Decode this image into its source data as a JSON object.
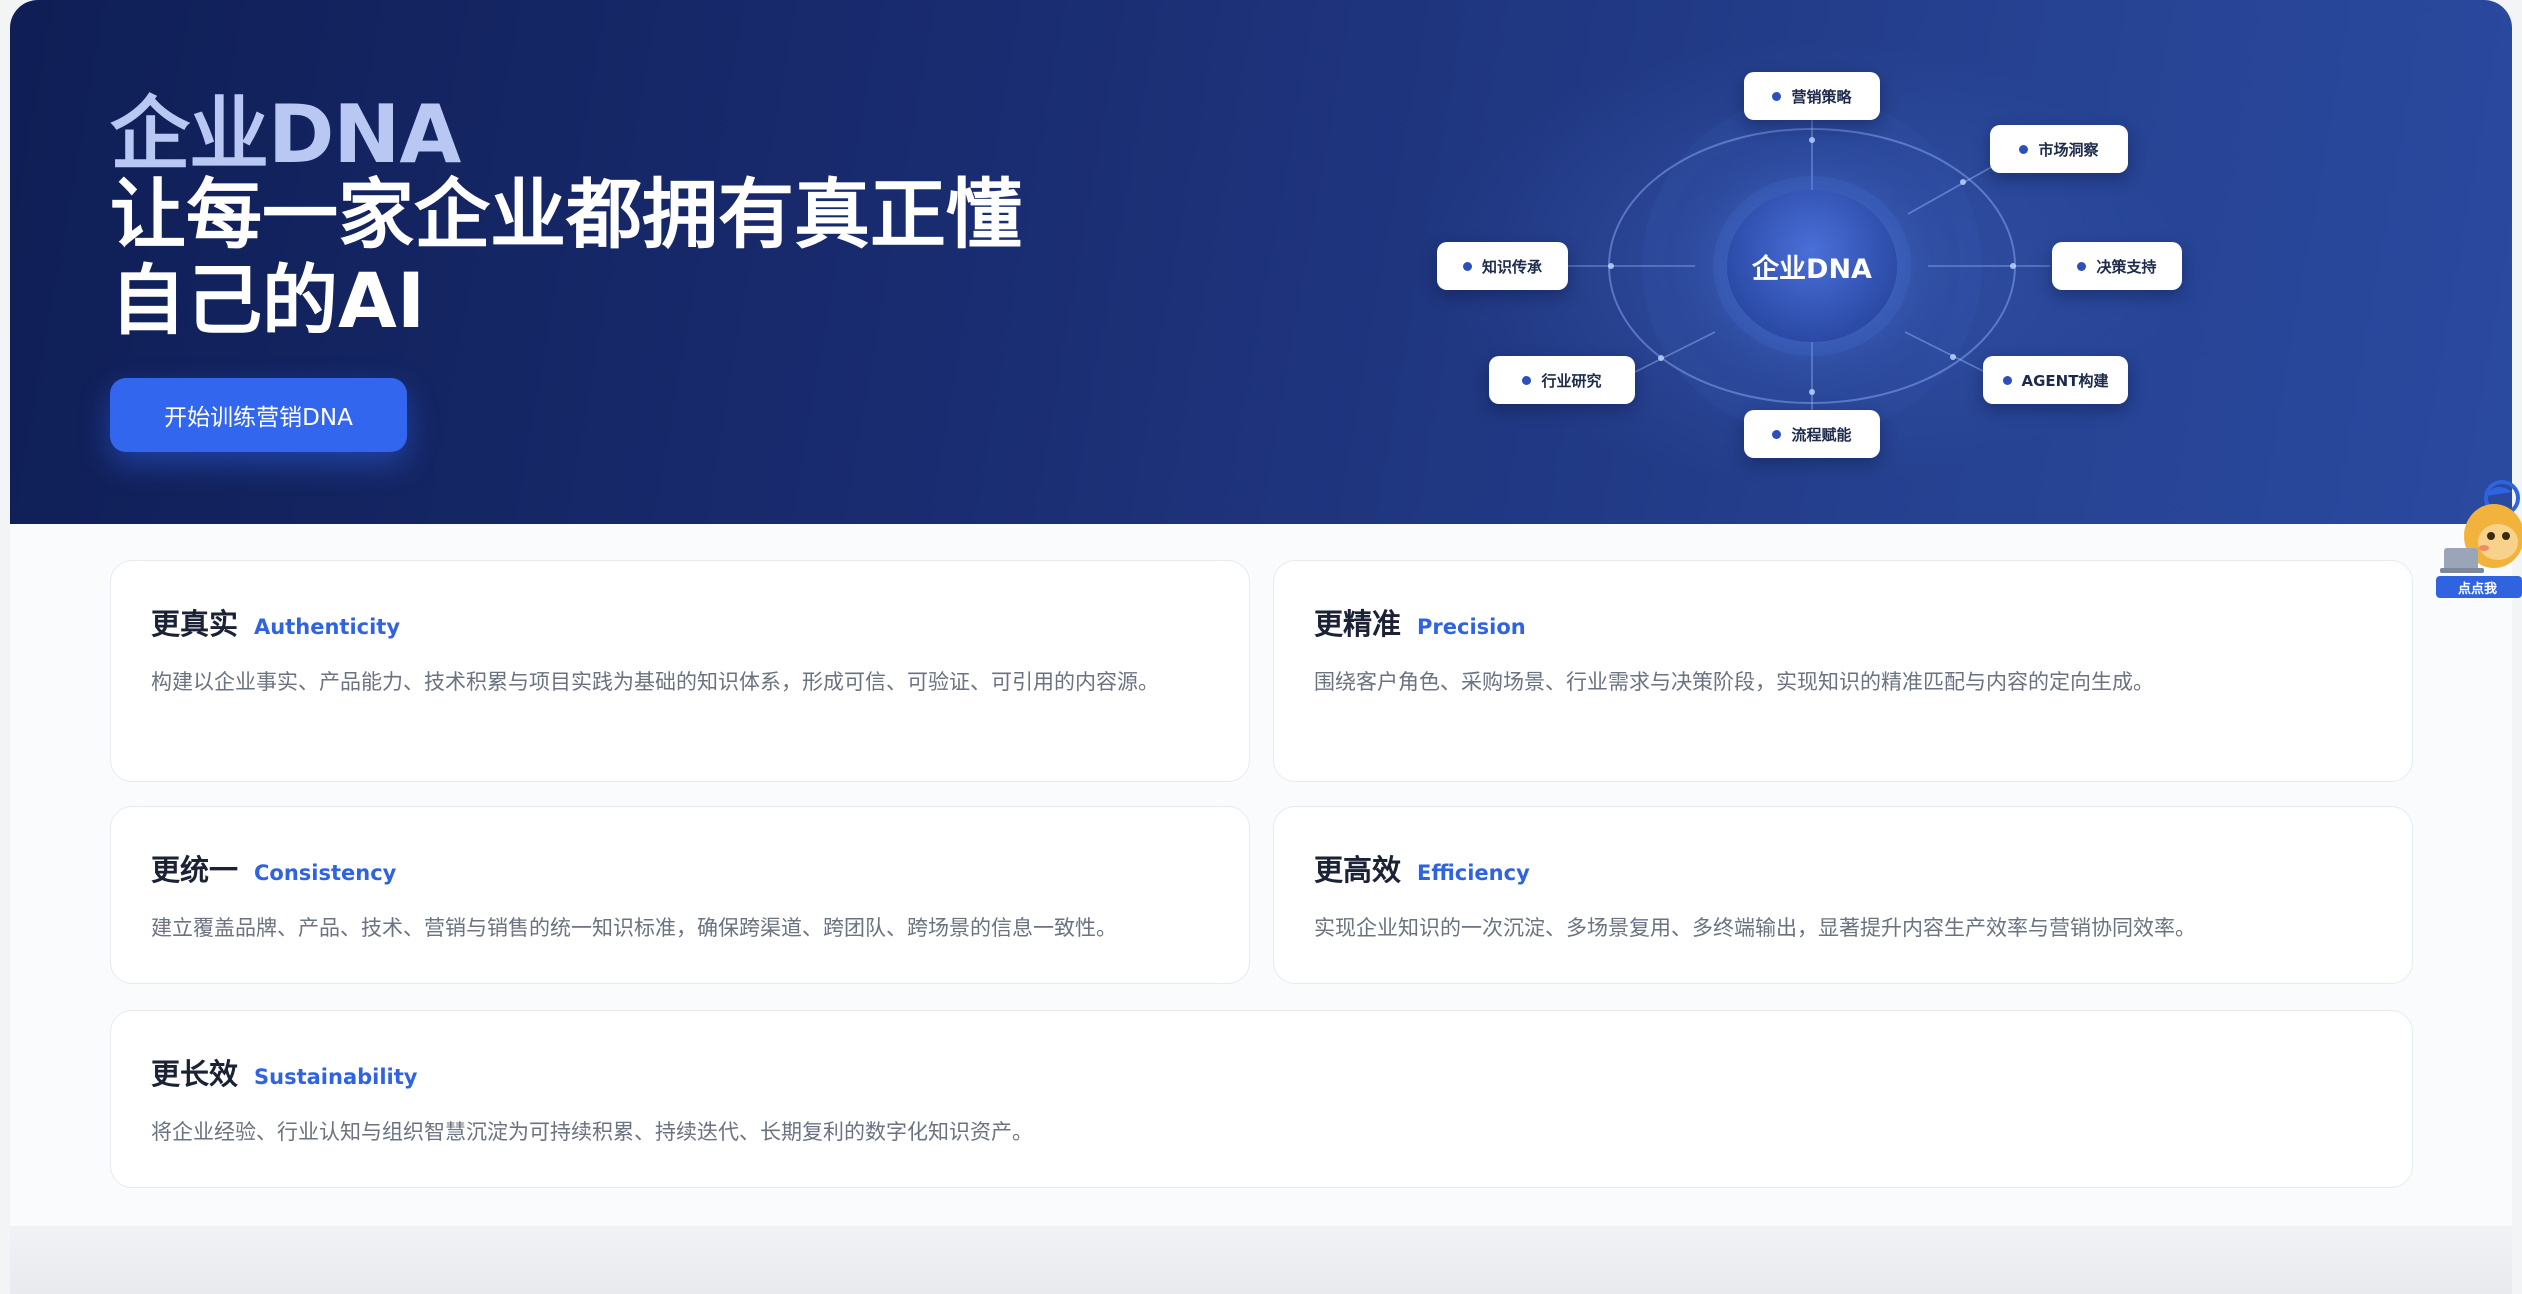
{
  "hero": {
    "brand": "企业DNA",
    "headline_line1": "让每一家企业都拥有真正懂",
    "headline_line2": "自己的AI",
    "cta_label": "开始训练营销DNA"
  },
  "diagram": {
    "center": "企业DNA",
    "nodes": {
      "marketing_strategy": "营销策略",
      "market_insight": "市场洞察",
      "decision_support": "决策支持",
      "agent_build": "AGENT构建",
      "process_enable": "流程赋能",
      "industry_research": "行业研究",
      "knowledge_inherit": "知识传承"
    }
  },
  "features": {
    "authenticity": {
      "title": "更真实",
      "en": "Authenticity",
      "desc": "构建以企业事实、产品能力、技术积累与项目实践为基础的知识体系，形成可信、可验证、可引用的内容源。"
    },
    "precision": {
      "title": "更精准",
      "en": "Precision",
      "desc": "围绕客户角色、采购场景、行业需求与决策阶段，实现知识的精准匹配与内容的定向生成。"
    },
    "consistency": {
      "title": "更统一",
      "en": "Consistency",
      "desc": "建立覆盖品牌、产品、技术、营销与销售的统一知识标准，确保跨渠道、跨团队、跨场景的信息一致性。"
    },
    "efficiency": {
      "title": "更高效",
      "en": "Efficiency",
      "desc": "实现企业知识的一次沉淀、多场景复用、多终端输出，显著提升内容生产效率与营销协同效率。"
    },
    "sustainability": {
      "title": "更长效",
      "en": "Sustainability",
      "desc": "将企业经验、行业认知与组织智慧沉淀为可持续积累、持续迭代、长期复利的数字化知识资产。"
    }
  },
  "mascot": {
    "label": "点点我"
  },
  "colors": {
    "accent": "#3266ee",
    "hero_dark": "#0f1e55",
    "hero_light": "#2a4aa0",
    "en_label": "#2f63e0"
  }
}
